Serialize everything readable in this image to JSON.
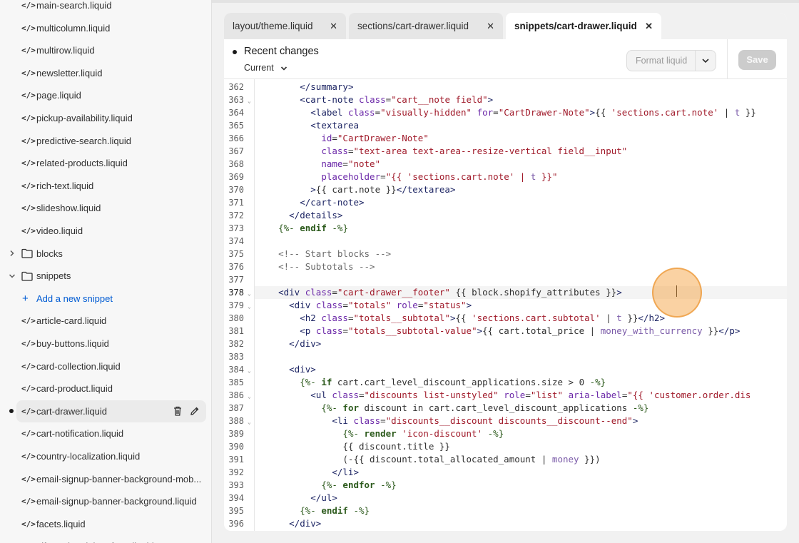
{
  "sidebar": {
    "files_top": [
      {
        "label": "main-search.liquid"
      },
      {
        "label": "multicolumn.liquid"
      },
      {
        "label": "multirow.liquid"
      },
      {
        "label": "newsletter.liquid"
      },
      {
        "label": "page.liquid"
      },
      {
        "label": "pickup-availability.liquid"
      },
      {
        "label": "predictive-search.liquid"
      },
      {
        "label": "related-products.liquid"
      },
      {
        "label": "rich-text.liquid"
      },
      {
        "label": "slideshow.liquid"
      },
      {
        "label": "video.liquid"
      }
    ],
    "folder_blocks": "blocks",
    "folder_snippets": "snippets",
    "add_snippet": "Add a new snippet",
    "files_snippets": [
      {
        "label": "article-card.liquid"
      },
      {
        "label": "buy-buttons.liquid"
      },
      {
        "label": "card-collection.liquid"
      },
      {
        "label": "card-product.liquid"
      },
      {
        "label": "cart-drawer.liquid"
      },
      {
        "label": "cart-notification.liquid"
      },
      {
        "label": "country-localization.liquid"
      },
      {
        "label": "email-signup-banner-background-mob..."
      },
      {
        "label": "email-signup-banner-background.liquid"
      },
      {
        "label": "facets.liquid"
      },
      {
        "label": "gift-card-recipient-form.liquid"
      }
    ],
    "file_icon": "</>",
    "active_file": "cart-drawer.liquid"
  },
  "tabs": [
    {
      "label": "layout/theme.liquid",
      "close": "✕"
    },
    {
      "label": "sections/cart-drawer.liquid",
      "close": "✕"
    },
    {
      "label": "snippets/cart-drawer.liquid",
      "close": "✕",
      "active": true
    }
  ],
  "header": {
    "title": "Recent changes",
    "version": "Current",
    "format_label": "Format liquid",
    "save_label": "Save"
  },
  "code": {
    "current_line": 378,
    "lines": [
      {
        "n": 362,
        "html": "        <span class=\"t-tag\">&lt;/summary&gt;</span>"
      },
      {
        "n": 363,
        "fold": true,
        "html": "        <span class=\"t-tag\">&lt;cart-note</span> <span class=\"t-attr\">class</span>=<span class=\"t-str\">\"cart__note field\"</span><span class=\"t-tag\">&gt;</span>"
      },
      {
        "n": 364,
        "html": "          <span class=\"t-tag\">&lt;label</span> <span class=\"t-attr\">class</span>=<span class=\"t-str\">\"visually-hidden\"</span> <span class=\"t-attr\">for</span>=<span class=\"t-str\">\"CartDrawer-Note\"</span><span class=\"t-tag\">&gt;</span>{{ <span class=\"t-str\">'sections.cart.note'</span> | <span class=\"t-fl\">t</span> }}"
      },
      {
        "n": 365,
        "html": "          <span class=\"t-tag\">&lt;textarea</span>"
      },
      {
        "n": 366,
        "html": "            <span class=\"t-attr\">id</span>=<span class=\"t-str\">\"CartDrawer-Note\"</span>"
      },
      {
        "n": 367,
        "html": "            <span class=\"t-attr\">class</span>=<span class=\"t-str\">\"text-area text-area--resize-vertical field__input\"</span>"
      },
      {
        "n": 368,
        "html": "            <span class=\"t-attr\">name</span>=<span class=\"t-str\">\"note\"</span>"
      },
      {
        "n": 369,
        "html": "            <span class=\"t-attr\">placeholder</span>=<span class=\"t-str\">\"{{ 'sections.cart.note' | <span class=\"t-fl\">t</span> }}\"</span>"
      },
      {
        "n": 370,
        "html": "          <span class=\"t-tag\">&gt;</span>{{ cart.note }}<span class=\"t-tag\">&lt;/textarea&gt;</span>"
      },
      {
        "n": 371,
        "html": "        <span class=\"t-tag\">&lt;/cart-note&gt;</span>"
      },
      {
        "n": 372,
        "html": "      <span class=\"t-tag\">&lt;/details&gt;</span>"
      },
      {
        "n": 373,
        "html": "    <span class=\"t-lq\">{%-</span> <span class=\"t-kw\">endif</span> <span class=\"t-lq\">-%}</span>"
      },
      {
        "n": 374,
        "html": ""
      },
      {
        "n": 375,
        "html": "    <span class=\"t-cm\">&lt;!-- Start blocks --&gt;</span>"
      },
      {
        "n": 376,
        "html": "    <span class=\"t-cm\">&lt;!-- Subtotals --&gt;</span>"
      },
      {
        "n": 377,
        "html": ""
      },
      {
        "n": 378,
        "fold": true,
        "html": "    <span class=\"t-tag\">&lt;div</span> <span class=\"t-attr\">class</span>=<span class=\"t-str\">\"cart-drawer__footer\"</span> {{ block.shopify_attributes }}<span class=\"t-tag\">&gt;</span>"
      },
      {
        "n": 379,
        "fold": true,
        "html": "      <span class=\"t-tag\">&lt;div</span> <span class=\"t-attr\">class</span>=<span class=\"t-str\">\"totals\"</span> <span class=\"t-attr\">role</span>=<span class=\"t-str\">\"status\"</span><span class=\"t-tag\">&gt;</span>"
      },
      {
        "n": 380,
        "html": "        <span class=\"t-tag\">&lt;h2</span> <span class=\"t-attr\">class</span>=<span class=\"t-str\">\"totals__subtotal\"</span><span class=\"t-tag\">&gt;</span>{{ <span class=\"t-str\">'sections.cart.subtotal'</span> | <span class=\"t-fl\">t</span> }}<span class=\"t-tag\">&lt;/h2&gt;</span>"
      },
      {
        "n": 381,
        "html": "        <span class=\"t-tag\">&lt;p</span> <span class=\"t-attr\">class</span>=<span class=\"t-str\">\"totals__subtotal-value\"</span><span class=\"t-tag\">&gt;</span>{{ cart.total_price | <span class=\"t-fl\">money_with_currency</span> }}<span class=\"t-tag\">&lt;/p&gt;</span>"
      },
      {
        "n": 382,
        "html": "      <span class=\"t-tag\">&lt;/div&gt;</span>"
      },
      {
        "n": 383,
        "html": ""
      },
      {
        "n": 384,
        "fold": true,
        "html": "      <span class=\"t-tag\">&lt;div&gt;</span>"
      },
      {
        "n": 385,
        "html": "        <span class=\"t-lq\">{%-</span> <span class=\"t-kw\">if</span> cart.cart_level_discount_applications.size &gt; 0 <span class=\"t-lq\">-%}</span>"
      },
      {
        "n": 386,
        "fold": true,
        "html": "          <span class=\"t-tag\">&lt;ul</span> <span class=\"t-attr\">class</span>=<span class=\"t-str\">\"discounts list-unstyled\"</span> <span class=\"t-attr\">role</span>=<span class=\"t-str\">\"list\"</span> <span class=\"t-attr\">aria-label</span>=<span class=\"t-str\">\"{{ 'customer.order.dis</span>"
      },
      {
        "n": 387,
        "html": "            <span class=\"t-lq\">{%-</span> <span class=\"t-kw\">for</span> discount in cart.cart_level_discount_applications <span class=\"t-lq\">-%}</span>"
      },
      {
        "n": 388,
        "fold": true,
        "html": "              <span class=\"t-tag\">&lt;li</span> <span class=\"t-attr\">class</span>=<span class=\"t-str\">\"discounts__discount discounts__discount--end\"</span><span class=\"t-tag\">&gt;</span>"
      },
      {
        "n": 389,
        "html": "                <span class=\"t-lq\">{%-</span> <span class=\"t-kw\">render</span> <span class=\"t-str\">'icon-discount'</span> <span class=\"t-lq\">-%}</span>"
      },
      {
        "n": 390,
        "html": "                {{ discount.title }}"
      },
      {
        "n": 391,
        "html": "                (-{{ discount.total_allocated_amount | <span class=\"t-fl\">money</span> }})"
      },
      {
        "n": 392,
        "html": "              <span class=\"t-tag\">&lt;/li&gt;</span>"
      },
      {
        "n": 393,
        "html": "            <span class=\"t-lq\">{%-</span> <span class=\"t-kw\">endfor</span> <span class=\"t-lq\">-%}</span>"
      },
      {
        "n": 394,
        "html": "          <span class=\"t-tag\">&lt;/ul&gt;</span>"
      },
      {
        "n": 395,
        "html": "        <span class=\"t-lq\">{%-</span> <span class=\"t-kw\">endif</span> <span class=\"t-lq\">-%}</span>"
      },
      {
        "n": 396,
        "html": "      <span class=\"t-tag\">&lt;/div&gt;</span>"
      }
    ]
  }
}
